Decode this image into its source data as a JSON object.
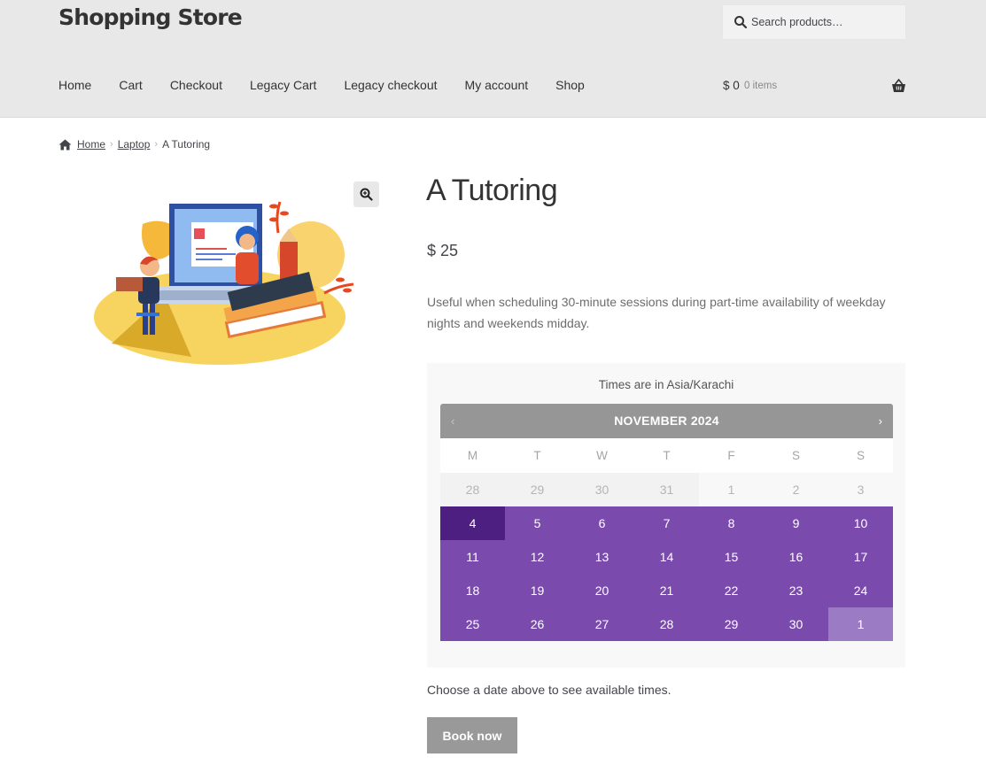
{
  "header": {
    "site_title": "Shopping Store",
    "search": {
      "placeholder": "Search products…",
      "icon": "search-icon"
    },
    "nav": [
      "Home",
      "Cart",
      "Checkout",
      "Legacy Cart",
      "Legacy checkout",
      "My account",
      "Shop"
    ],
    "cart": {
      "amount": "$ 0",
      "count": "0 items",
      "icon": "basket-icon"
    }
  },
  "breadcrumb": {
    "home": "Home",
    "category": "Laptop",
    "current": "A Tutoring"
  },
  "product": {
    "title": "A Tutoring",
    "price": "$ 25",
    "description": "Useful when scheduling 30-minute sessions during part-time availability of weekday nights and weekends midday."
  },
  "booking": {
    "timezone_note": "Times are in Asia/Karachi",
    "calendar": {
      "month_label": "NOVEMBER 2024",
      "prev_label": "‹",
      "next_label": "›",
      "weekdays": [
        "M",
        "T",
        "W",
        "T",
        "F",
        "S",
        "S"
      ],
      "weeks": [
        [
          {
            "d": "28",
            "s": "muted"
          },
          {
            "d": "29",
            "s": "muted"
          },
          {
            "d": "30",
            "s": "muted"
          },
          {
            "d": "31",
            "s": "muted"
          },
          {
            "d": "1",
            "s": "muted-alt"
          },
          {
            "d": "2",
            "s": "muted-alt"
          },
          {
            "d": "3",
            "s": "muted-alt"
          }
        ],
        [
          {
            "d": "4",
            "s": "selected"
          },
          {
            "d": "5",
            "s": "active"
          },
          {
            "d": "6",
            "s": "active"
          },
          {
            "d": "7",
            "s": "active"
          },
          {
            "d": "8",
            "s": "active"
          },
          {
            "d": "9",
            "s": "active"
          },
          {
            "d": "10",
            "s": "active"
          }
        ],
        [
          {
            "d": "11",
            "s": "active"
          },
          {
            "d": "12",
            "s": "active"
          },
          {
            "d": "13",
            "s": "active"
          },
          {
            "d": "14",
            "s": "active"
          },
          {
            "d": "15",
            "s": "active"
          },
          {
            "d": "16",
            "s": "active"
          },
          {
            "d": "17",
            "s": "active"
          }
        ],
        [
          {
            "d": "18",
            "s": "active"
          },
          {
            "d": "19",
            "s": "active"
          },
          {
            "d": "20",
            "s": "active"
          },
          {
            "d": "21",
            "s": "active"
          },
          {
            "d": "22",
            "s": "active"
          },
          {
            "d": "23",
            "s": "active"
          },
          {
            "d": "24",
            "s": "active"
          }
        ],
        [
          {
            "d": "25",
            "s": "active"
          },
          {
            "d": "26",
            "s": "active"
          },
          {
            "d": "27",
            "s": "active"
          },
          {
            "d": "28",
            "s": "active"
          },
          {
            "d": "29",
            "s": "active"
          },
          {
            "d": "30",
            "s": "active"
          },
          {
            "d": "1",
            "s": "next-month"
          }
        ]
      ],
      "colors": {
        "header": "#969696",
        "bookable": "#7a4aad",
        "selected": "#4d1f80",
        "next_month": "#9b7bc4"
      }
    },
    "hint": "Choose a date above to see available times.",
    "book_label": "Book now"
  }
}
